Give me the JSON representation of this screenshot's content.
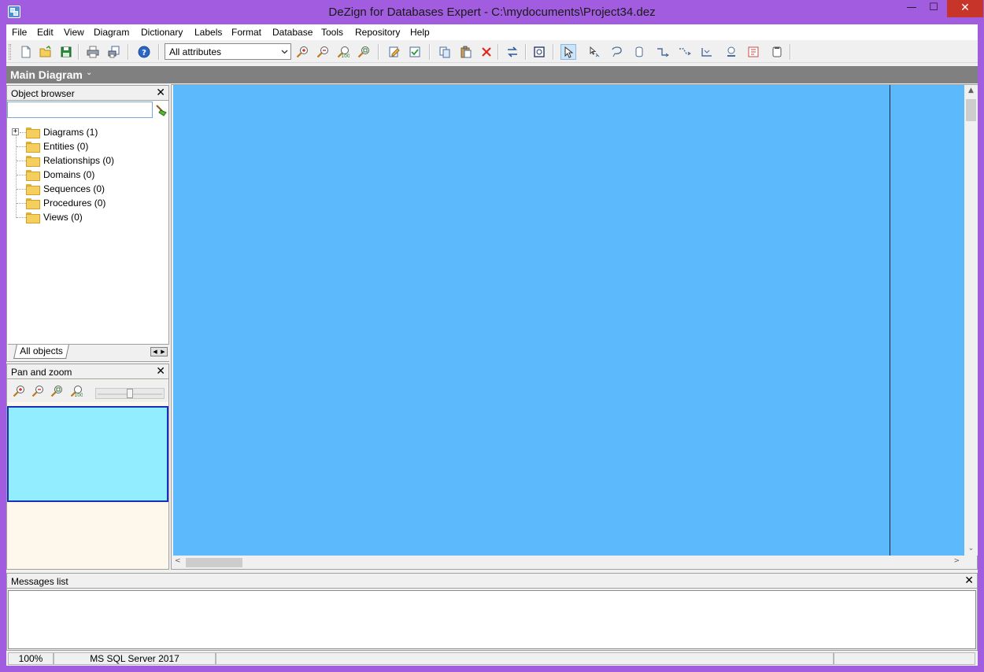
{
  "window": {
    "title": "DeZign for Databases Expert - C:\\mydocuments\\Project34.dez",
    "minimize_glyph": "—",
    "maximize_glyph": "☐",
    "close_glyph": "✕"
  },
  "menu": [
    "File",
    "Edit",
    "View",
    "Diagram",
    "Dictionary",
    "Labels",
    "Format",
    "Database",
    "Tools",
    "Repository",
    "Help"
  ],
  "toolbar": {
    "attribute_filter": "All attributes",
    "icons": [
      "new-file-icon",
      "open-folder-icon",
      "save-icon",
      "print-icon",
      "print-preview-icon",
      "help-icon",
      "zoom-in-icon",
      "zoom-out-icon",
      "zoom-fit-icon",
      "zoom-actual-icon",
      "edit-entity-icon",
      "check-model-icon",
      "copy-icon",
      "paste-icon",
      "delete-icon",
      "swap-icon",
      "page-setup-icon",
      "pointer-icon",
      "select-relationship-icon",
      "lasso-icon",
      "entity-tool-icon",
      "relationship-tool-icon",
      "identifying-relationship-icon",
      "self-relationship-icon",
      "stamp-icon",
      "note-icon",
      "frame-icon"
    ]
  },
  "diagram_tab": {
    "label": "Main Diagram",
    "caret": "⌄"
  },
  "object_browser": {
    "title": "Object browser",
    "close": "✕",
    "search_value": "",
    "items": [
      {
        "label": "Diagrams (1)",
        "expandable": true
      },
      {
        "label": "Entities (0)",
        "expandable": false
      },
      {
        "label": "Relationships (0)",
        "expandable": false
      },
      {
        "label": "Domains (0)",
        "expandable": false
      },
      {
        "label": "Sequences (0)",
        "expandable": false
      },
      {
        "label": "Procedures (0)",
        "expandable": false
      },
      {
        "label": "Views (0)",
        "expandable": false
      }
    ],
    "tab": "All objects",
    "expander_glyph": "+",
    "tab_arrows": [
      "◀",
      "▶"
    ]
  },
  "pan_zoom": {
    "title": "Pan and zoom",
    "close": "✕",
    "slider_level": 0.5
  },
  "messages": {
    "title": "Messages list",
    "close": "✕"
  },
  "status": {
    "zoom": "100%",
    "database": "MS SQL Server 2017"
  },
  "scroll_glyphs": {
    "up": "▲",
    "down": "⌄",
    "left": "<",
    "right": ">"
  },
  "colors": {
    "window_frame": "#a25ce0",
    "canvas": "#5cbafc",
    "pan_view": "#92eeff",
    "pan_view_border": "#1a2fbf",
    "pan_panel_bg": "#fef8ec"
  }
}
